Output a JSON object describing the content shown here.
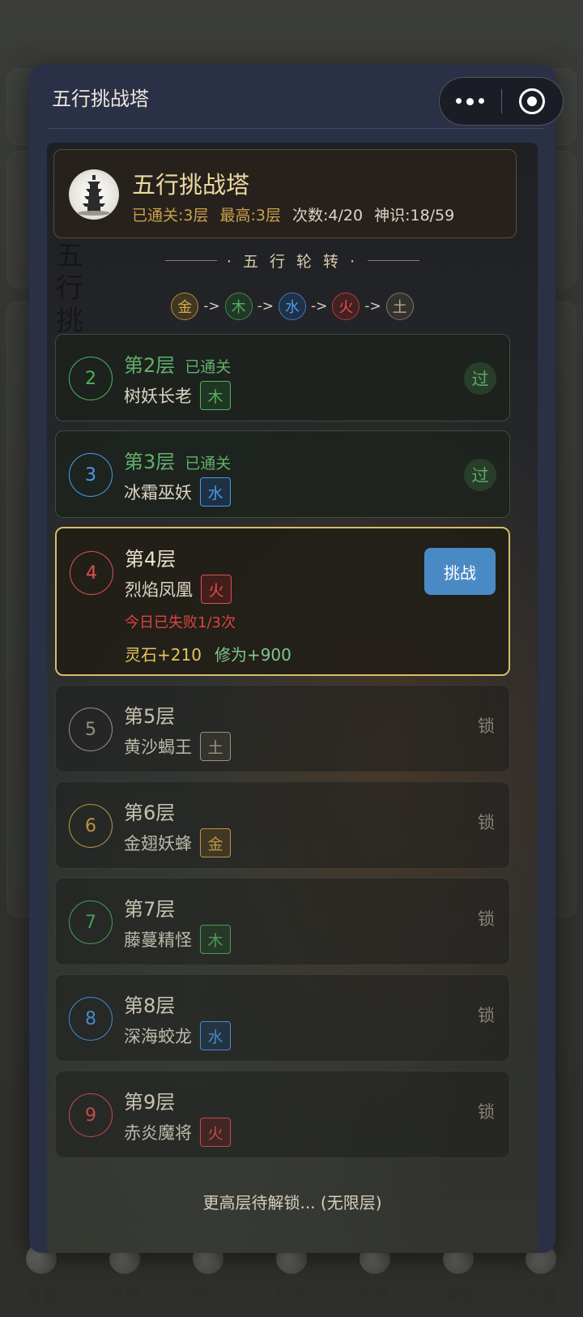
{
  "modal": {
    "title": "五行挑战塔"
  },
  "header": {
    "title": "五行挑战塔",
    "cleared": "已通关:3层",
    "highest": "最高:3层",
    "attempts": "次数:4/20",
    "spirit": "神识:18/59"
  },
  "rotation": {
    "label": "· 五 行 轮 转 ·",
    "chain": [
      "金",
      "木",
      "水",
      "火",
      "土"
    ],
    "arrow": "->"
  },
  "panel_bg_text": "五行挑",
  "levels": [
    {
      "num": "2",
      "name": "第2层",
      "status": "已通关",
      "boss": "树妖长老",
      "element": "木",
      "right": "过"
    },
    {
      "num": "3",
      "name": "第3层",
      "status": "已通关",
      "boss": "冰霜巫妖",
      "element": "水",
      "right": "过"
    },
    {
      "num": "4",
      "name": "第4层",
      "boss": "烈焰凤凰",
      "element": "火",
      "button": "挑战",
      "fail": "今日已失败1/3次",
      "reward_stone": "灵石+210",
      "reward_xiu": "修为+900"
    },
    {
      "num": "5",
      "name": "第5层",
      "boss": "黄沙蝎王",
      "element": "土",
      "right": "锁"
    },
    {
      "num": "6",
      "name": "第6层",
      "boss": "金翅妖蜂",
      "element": "金",
      "right": "锁"
    },
    {
      "num": "7",
      "name": "第7层",
      "boss": "藤蔓精怪",
      "element": "木",
      "right": "锁"
    },
    {
      "num": "8",
      "name": "第8层",
      "boss": "深海蛟龙",
      "element": "水",
      "right": "锁"
    },
    {
      "num": "9",
      "name": "第9层",
      "boss": "赤炎魔将",
      "element": "火",
      "right": "锁"
    }
  ],
  "more": "更高层待解锁... (无限层)",
  "bottom_nav": [
    "背包",
    "灵根",
    "宗门",
    "功法",
    "伙伴",
    "探索",
    "设置"
  ],
  "colors": {
    "jin": "#d8a84a",
    "mu": "#4fb25c",
    "shui": "#4a9ce8",
    "huo": "#e05050",
    "tu": "#b0a690",
    "accent_gold": "#d8bc6a",
    "button_blue": "#4a8ac4"
  }
}
